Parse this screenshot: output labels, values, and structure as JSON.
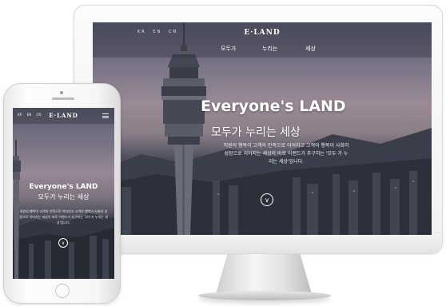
{
  "brand": {
    "logo": "E·LAND"
  },
  "desktop": {
    "lang_options": [
      "KR",
      "EN",
      "CN"
    ],
    "nav": [
      {
        "label": "모두가"
      },
      {
        "label": "누리는"
      },
      {
        "label": "세상"
      }
    ],
    "hero": {
      "title": "Everyone's LAND",
      "subtitle": "모두가 누리는 세상",
      "description": "직원의 행복이 고객의 만족으로 이어지고 고객의 행복이 사회의 성장으로 이어지는 세상의 바로 이랜드가 추구하는 '모두 가 누리는 세상'입니다."
    },
    "scroll_icon": "chevron-down-icon"
  },
  "mobile": {
    "lang_options": [
      "KR",
      "EN",
      "CN"
    ],
    "hero": {
      "title": "Everyone's LAND",
      "subtitle": "모두가 누리는 세상",
      "description": "직원의 행복이 고객의 만족으로 이어지고 고객의 행복이 사회의 성장으로 이어지는 세상이 바로 이랜드가 추구하는 '모두가 누리는 세상'입니다."
    },
    "menu_icon": "hamburger-icon",
    "scroll_icon": "chevron-down-icon"
  }
}
